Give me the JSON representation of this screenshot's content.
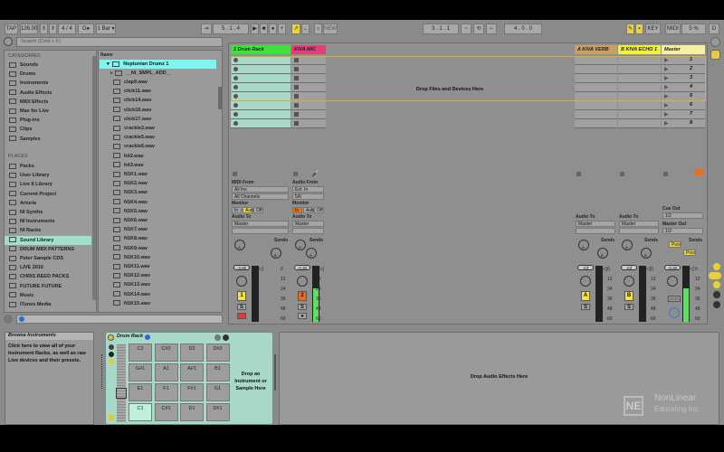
{
  "toolbar": {
    "tap": "TAP",
    "tempo": "126.00",
    "signature": "4 / 4",
    "metronome": "O●",
    "quantize": "1 Bar",
    "position": "5 . 1 . 4",
    "new": "NEW",
    "loop_start": "3 . 1 . 1",
    "loop_length": "4 . 0 . 0",
    "key": "KEY",
    "midi": "MIDI",
    "cpu": "5 %",
    "disk": "D"
  },
  "browser": {
    "search_placeholder": "Search (Cmd + F)",
    "categories_title": "CATEGORIES",
    "categories": [
      "Sounds",
      "Drums",
      "Instruments",
      "Audio Effects",
      "MIDI Effects",
      "Max for Live",
      "Plug-ins",
      "Clips",
      "Samples"
    ],
    "places_title": "PLACES",
    "places": [
      "Packs",
      "User Library",
      "Live 8 Library",
      "Current Project",
      "Arturia",
      "NI Synths",
      "NI Instruments",
      "NI Racks",
      "Sound Library",
      "DRUM MIDI PATTERNS",
      "Peter Sample CDS",
      "LIVE 2016",
      "CHRIS REED PACKS",
      "FUTURE FUTURE",
      "Music",
      "iTunes Media"
    ],
    "selected_place": "Sound Library",
    "name_header": "Name",
    "folder": "Neptunian Drumz 1",
    "subfolder": "__NI_SMPL_ADD__",
    "files": [
      "clap9.wav",
      "click11.wav",
      "click14.wav",
      "click16.wav",
      "click17.wav",
      "crackle2.wav",
      "crackle5.wav",
      "crackle6.wav",
      "hit2.wav",
      "hit3.wav",
      "N1K1.wav",
      "N1K2.wav",
      "N1K3.wav",
      "N1K4.wav",
      "N1K5.wav",
      "N1K6.wav",
      "N1K7.wav",
      "N1K8.wav",
      "N1K9.wav",
      "N1K10.wav",
      "N1K11.wav",
      "N1K12.wav",
      "N1K13.wav",
      "N1K14.wav",
      "N1K15.wav"
    ]
  },
  "session": {
    "drop_text": "Drop Files and Devices Here",
    "scenes": [
      "1",
      "2",
      "3",
      "4",
      "5",
      "6",
      "7",
      "8"
    ],
    "tracks": [
      {
        "name": "1 Drum Rack",
        "color": "#3ee03a",
        "volume": "-3.90",
        "number": "1",
        "input_label": "MIDI From",
        "input": "All Ins",
        "channel": "All Channels"
      },
      {
        "name": "KIVA MIC",
        "color": "#e23e7a",
        "volume": "-0.30",
        "number": "2",
        "input_label": "Audio From",
        "input": "Ext. In",
        "channel": "5/6"
      },
      {
        "name": "A KIVA VERB",
        "color": "#c8a064",
        "volume": "-inf",
        "number": "A"
      },
      {
        "name": "B KIVA ECHO 1",
        "color": "#f2f23a",
        "volume": "-inf",
        "number": "B"
      },
      {
        "name": "Master",
        "color": "#f4f0a0",
        "volume": "-0.30"
      }
    ],
    "monitor_label": "Monitor",
    "monitor": [
      "In",
      "Auto",
      "Off"
    ],
    "audio_to_label": "Audio To",
    "audio_to": "Master",
    "sends_label": "Sends",
    "send_a": "A",
    "send_b": "B",
    "solo": "S",
    "cue_out_label": "Cue Out",
    "cue_out": "1/2",
    "master_out_label": "Master Out",
    "master_out": "1/2",
    "post": "Post",
    "solo_master": "Solo",
    "meter_scale": [
      "0",
      "12",
      "24",
      "36",
      "48",
      "60"
    ]
  },
  "detail": {
    "info_title": "Browse Instruments",
    "info_text": "Click here to view all of your Instrument Racks, as well as raw Live devices and their presets.",
    "device_name": "Drum Rack",
    "pads": [
      "C2",
      "C#2",
      "D2",
      "D#2",
      "G#1",
      "A1",
      "A#1",
      "B1",
      "E1",
      "F1",
      "F#1",
      "G1",
      "C1",
      "C#1",
      "D1",
      "D#1"
    ],
    "drop_instrument": "Drop an Instrument or Sample Here",
    "drop_effects": "Drop Audio Effects Here"
  },
  "watermark": {
    "line1": "NonLinear",
    "line2": "Educating Inc.",
    "logo": "NE"
  }
}
